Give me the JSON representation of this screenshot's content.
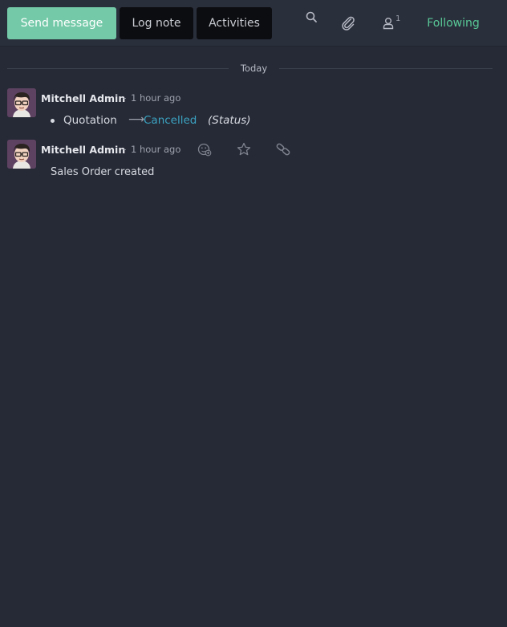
{
  "toolbar": {
    "send_message_label": "Send message",
    "log_note_label": "Log note",
    "activities_label": "Activities",
    "search_icon": "search-icon",
    "attachment_icon": "paperclip-icon",
    "followers_icon": "user-icon",
    "followers_count": "1",
    "following_label": "Following"
  },
  "thread": {
    "date_separator": "Today",
    "messages": [
      {
        "author": "Mitchell Admin",
        "separator": "-",
        "time": "1 hour ago",
        "tracking": {
          "field": "Quotation",
          "new_value": "Cancelled",
          "field_desc": "(Status)"
        }
      },
      {
        "author": "Mitchell Admin",
        "separator": "-",
        "time": "1 hour ago",
        "body": "Sales Order created",
        "actions": [
          "add-reaction-icon",
          "star-icon",
          "link-icon"
        ]
      }
    ]
  },
  "colors": {
    "background": "#262a36",
    "primary_button": "#73c9a8",
    "following": "#58c896",
    "tracking_value": "#3ba3c2"
  }
}
